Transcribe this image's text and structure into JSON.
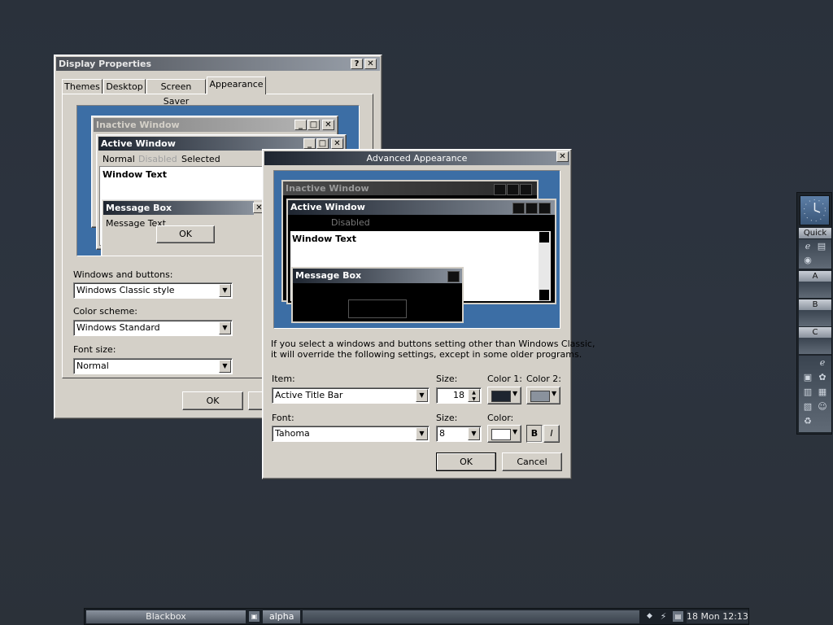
{
  "display_props": {
    "title": "Display Properties",
    "tabs": [
      "Themes",
      "Desktop",
      "Screen Saver",
      "Appearance"
    ],
    "preview": {
      "inactive_title": "Inactive Window",
      "active_title": "Active Window",
      "menu_normal": "Normal",
      "menu_disabled": "Disabled",
      "menu_selected": "Selected",
      "window_text": "Window Text",
      "msgbox_title": "Message Box",
      "msgbox_text": "Message Text",
      "ok": "OK"
    },
    "windows_buttons_label": "Windows and buttons:",
    "windows_buttons_value": "Windows Classic style",
    "color_scheme_label": "Color scheme:",
    "color_scheme_value": "Windows Standard",
    "font_size_label": "Font size:",
    "font_size_value": "Normal",
    "ok": "OK"
  },
  "advanced": {
    "title": "Advanced Appearance",
    "preview": {
      "inactive_title": "Inactive Window",
      "active_title": "Active Window",
      "menu_disabled": "Disabled",
      "window_text": "Window Text",
      "msgbox_title": "Message Box"
    },
    "note_line1": "If you select a windows and buttons setting other than Windows Classic,",
    "note_line2": "it will override the following settings, except in some older programs.",
    "item_label": "Item:",
    "item_value": "Active Title Bar",
    "size_label": "Size:",
    "size_value": "18",
    "color1_label": "Color 1:",
    "color2_label": "Color 2:",
    "color1": "#1e2530",
    "color2": "#8a929d",
    "font_label": "Font:",
    "font_value": "Tahoma",
    "font_size_label": "Size:",
    "font_size_value": "8",
    "font_color_label": "Color:",
    "font_color": "#ffffff",
    "bold": "B",
    "italic": "I",
    "ok": "OK",
    "cancel": "Cancel"
  },
  "slit": {
    "quick": "Quick",
    "a": "A",
    "b": "B",
    "c": "C",
    "icons": [
      "ie-icon",
      "doc-icon",
      "media-icon",
      "ie2-icon",
      "bag-icon",
      "film-icon",
      "tool-icon",
      "trash-icon",
      "scroll-icon",
      "note-icon",
      "recycle-icon"
    ]
  },
  "taskbar": {
    "workspace": "Blackbox",
    "window": "alpha",
    "clock": "18 Mon 12:13"
  }
}
